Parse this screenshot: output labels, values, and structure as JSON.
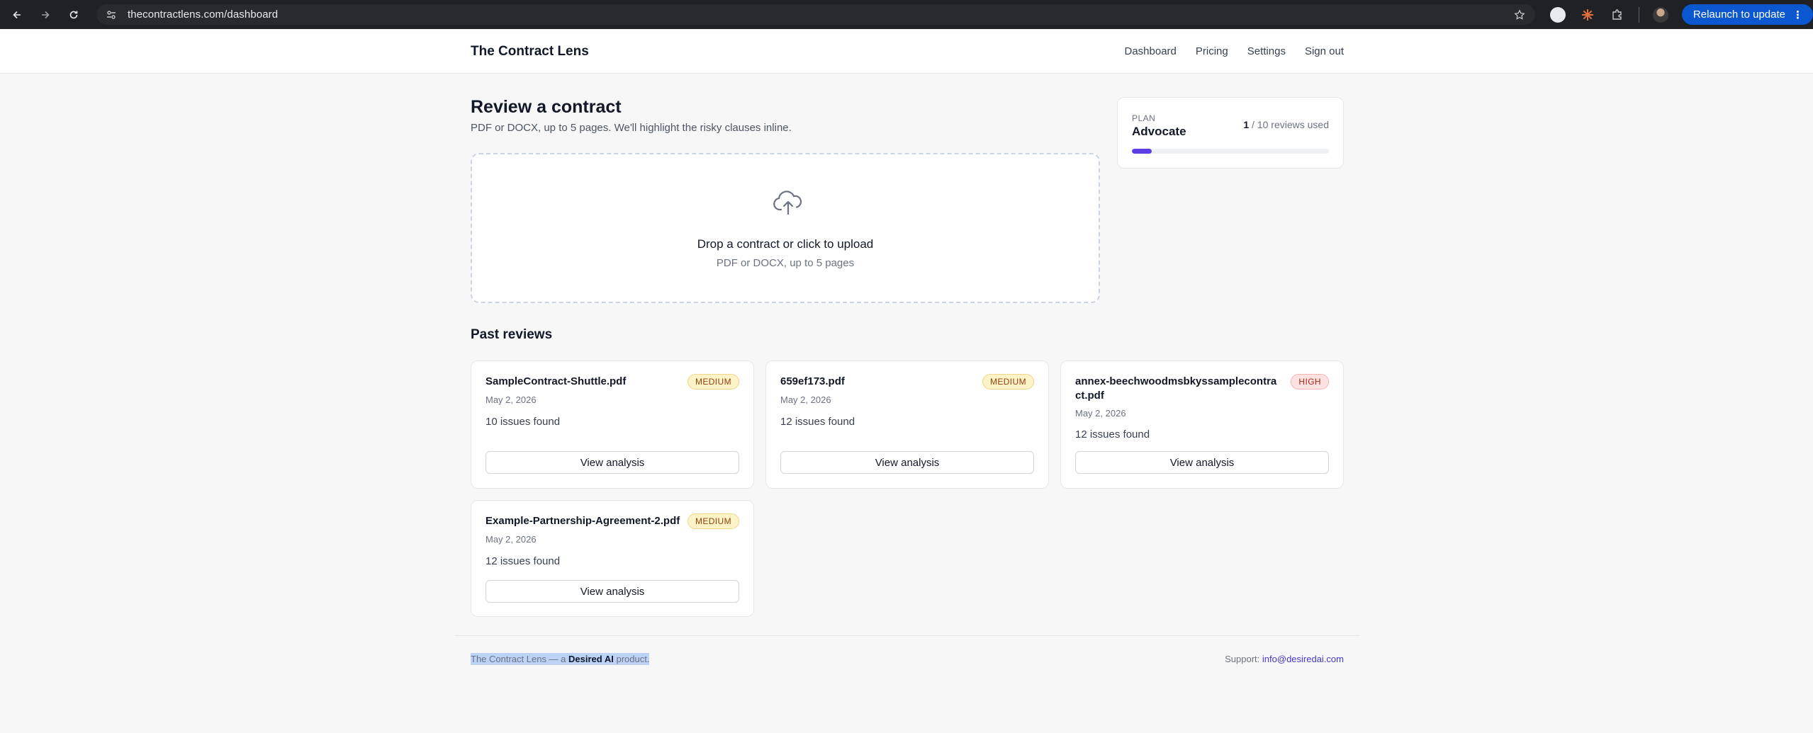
{
  "browser": {
    "url": "thecontractlens.com/dashboard",
    "relaunch_label": "Relaunch to update"
  },
  "header": {
    "brand": "The Contract Lens",
    "nav": [
      "Dashboard",
      "Pricing",
      "Settings",
      "Sign out"
    ]
  },
  "review": {
    "title": "Review a contract",
    "subtitle": "PDF or DOCX, up to 5 pages. We'll highlight the risky clauses inline.",
    "dropzone_title": "Drop a contract or click to upload",
    "dropzone_subtitle": "PDF or DOCX, up to 5 pages"
  },
  "plan": {
    "label": "PLAN",
    "name": "Advocate",
    "used": "1",
    "usage_suffix": "/ 10 reviews used",
    "usage_fraction": 0.1,
    "accent_color": "#5b3ee6"
  },
  "past_reviews": {
    "title": "Past reviews",
    "button_label": "View analysis",
    "items": [
      {
        "name": "SampleContract-Shuttle.pdf",
        "risk": "MEDIUM",
        "date": "May 2, 2026",
        "issues": "10 issues found"
      },
      {
        "name": "659ef173.pdf",
        "risk": "MEDIUM",
        "date": "May 2, 2026",
        "issues": "12 issues found"
      },
      {
        "name": "annex-beechwoodmsbkyssamplecontract.pdf",
        "risk": "HIGH",
        "date": "May 2, 2026",
        "issues": "12 issues found"
      },
      {
        "name": "Example-Partnership-Agreement-2.pdf",
        "risk": "MEDIUM",
        "date": "May 2, 2026",
        "issues": "12 issues found"
      }
    ]
  },
  "footer": {
    "left_prefix": "The Contract Lens — a",
    "left_brand": "Desired AI",
    "left_suffix": "product.",
    "support_label": "Support:",
    "support_email": "info@desiredai.com"
  }
}
